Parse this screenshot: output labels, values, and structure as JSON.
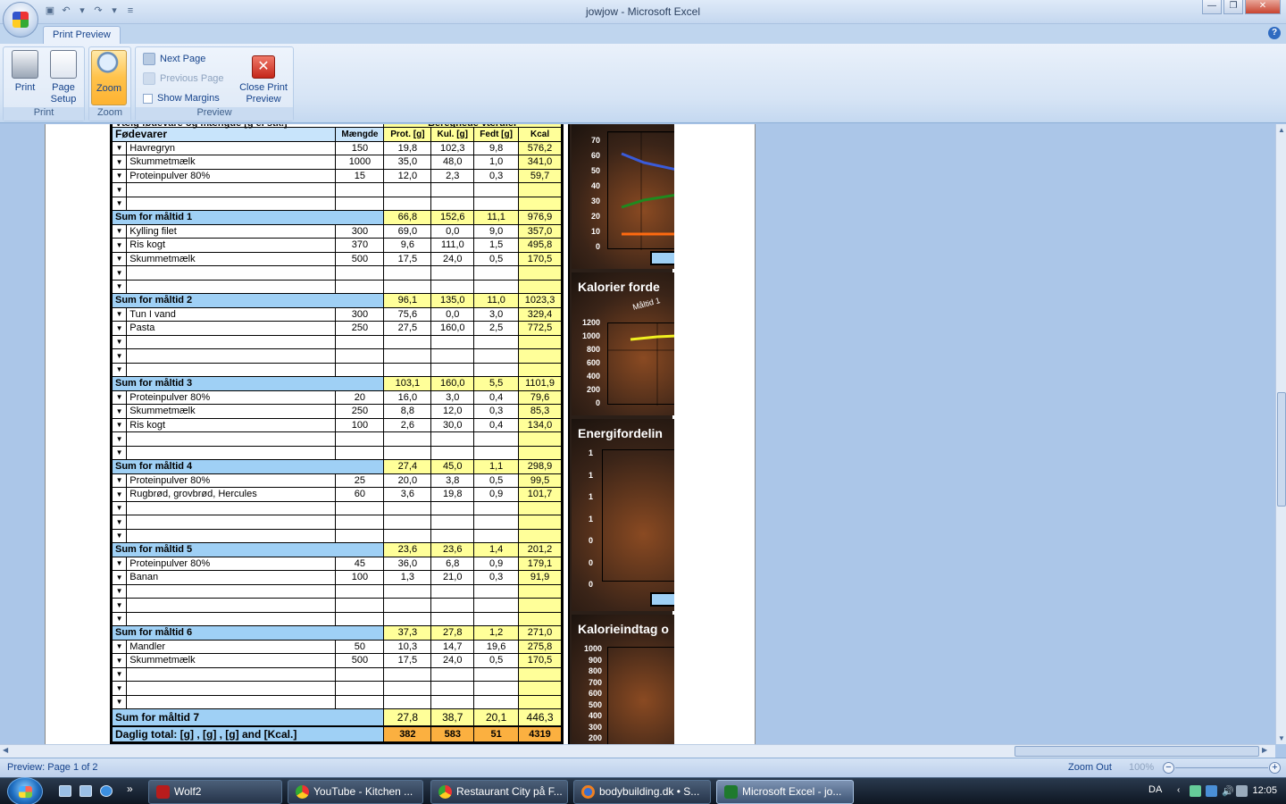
{
  "window": {
    "title": "jowjow - Microsoft Excel"
  },
  "ribbon": {
    "tab": "Print Preview",
    "print_label": "Print",
    "page_setup_label": "Page\nSetup",
    "zoom_label": "Zoom",
    "next_page": "Next Page",
    "previous_page": "Previous Page",
    "show_margins": "Show Margins",
    "close_label": "Close Print\nPreview",
    "group_print": "Print",
    "group_zoom": "Zoom",
    "group_preview": "Preview"
  },
  "sheet": {
    "partial_header_left": "Vælg fødevare og mængde [g el stk.]",
    "partial_header_right": "Beregnede værdier",
    "columns": [
      "Fødevarer",
      "Mængde",
      "Prot. [g]",
      "Kul. [g]",
      "Fedt [g]",
      "Kcal"
    ],
    "rows": [
      {
        "t": "f",
        "name": "Havregryn",
        "qty": "150",
        "p": "19,8",
        "k": "102,3",
        "f": "9,8",
        "kcal": "576,2"
      },
      {
        "t": "f",
        "name": "Skummetmælk",
        "qty": "1000",
        "p": "35,0",
        "k": "48,0",
        "f": "1,0",
        "kcal": "341,0"
      },
      {
        "t": "f",
        "name": "Proteinpulver 80%",
        "qty": "15",
        "p": "12,0",
        "k": "2,3",
        "f": "0,3",
        "kcal": "59,7"
      },
      {
        "t": "f",
        "name": "",
        "qty": "",
        "p": "",
        "k": "",
        "f": "",
        "kcal": ""
      },
      {
        "t": "f",
        "name": "",
        "qty": "",
        "p": "",
        "k": "",
        "f": "",
        "kcal": ""
      },
      {
        "t": "s",
        "name": "Sum for måltid 1",
        "p": "66,8",
        "k": "152,6",
        "f": "11,1",
        "kcal": "976,9"
      },
      {
        "t": "f",
        "name": "Kylling filet",
        "qty": "300",
        "p": "69,0",
        "k": "0,0",
        "f": "9,0",
        "kcal": "357,0"
      },
      {
        "t": "f",
        "name": "Ris kogt",
        "qty": "370",
        "p": "9,6",
        "k": "111,0",
        "f": "1,5",
        "kcal": "495,8"
      },
      {
        "t": "f",
        "name": "Skummetmælk",
        "qty": "500",
        "p": "17,5",
        "k": "24,0",
        "f": "0,5",
        "kcal": "170,5"
      },
      {
        "t": "f",
        "name": "",
        "qty": "",
        "p": "",
        "k": "",
        "f": "",
        "kcal": ""
      },
      {
        "t": "f",
        "name": "",
        "qty": "",
        "p": "",
        "k": "",
        "f": "",
        "kcal": ""
      },
      {
        "t": "s",
        "name": "Sum for måltid 2",
        "p": "96,1",
        "k": "135,0",
        "f": "11,0",
        "kcal": "1023,3"
      },
      {
        "t": "f",
        "name": "Tun I vand",
        "qty": "300",
        "p": "75,6",
        "k": "0,0",
        "f": "3,0",
        "kcal": "329,4"
      },
      {
        "t": "f",
        "name": "Pasta",
        "qty": "250",
        "p": "27,5",
        "k": "160,0",
        "f": "2,5",
        "kcal": "772,5"
      },
      {
        "t": "f",
        "name": "",
        "qty": "",
        "p": "",
        "k": "",
        "f": "",
        "kcal": ""
      },
      {
        "t": "f",
        "name": "",
        "qty": "",
        "p": "",
        "k": "",
        "f": "",
        "kcal": ""
      },
      {
        "t": "f",
        "name": "",
        "qty": "",
        "p": "",
        "k": "",
        "f": "",
        "kcal": ""
      },
      {
        "t": "s",
        "name": "Sum for måltid 3",
        "p": "103,1",
        "k": "160,0",
        "f": "5,5",
        "kcal": "1101,9"
      },
      {
        "t": "f",
        "name": "Proteinpulver 80%",
        "qty": "20",
        "p": "16,0",
        "k": "3,0",
        "f": "0,4",
        "kcal": "79,6"
      },
      {
        "t": "f",
        "name": "Skummetmælk",
        "qty": "250",
        "p": "8,8",
        "k": "12,0",
        "f": "0,3",
        "kcal": "85,3"
      },
      {
        "t": "f",
        "name": "Ris kogt",
        "qty": "100",
        "p": "2,6",
        "k": "30,0",
        "f": "0,4",
        "kcal": "134,0"
      },
      {
        "t": "f",
        "name": "",
        "qty": "",
        "p": "",
        "k": "",
        "f": "",
        "kcal": ""
      },
      {
        "t": "f",
        "name": "",
        "qty": "",
        "p": "",
        "k": "",
        "f": "",
        "kcal": ""
      },
      {
        "t": "s",
        "name": "Sum for måltid 4",
        "p": "27,4",
        "k": "45,0",
        "f": "1,1",
        "kcal": "298,9"
      },
      {
        "t": "f",
        "name": "Proteinpulver 80%",
        "qty": "25",
        "p": "20,0",
        "k": "3,8",
        "f": "0,5",
        "kcal": "99,5"
      },
      {
        "t": "f",
        "name": "Rugbrød, grovbrød, Hercules",
        "qty": "60",
        "p": "3,6",
        "k": "19,8",
        "f": "0,9",
        "kcal": "101,7"
      },
      {
        "t": "f",
        "name": "",
        "qty": "",
        "p": "",
        "k": "",
        "f": "",
        "kcal": ""
      },
      {
        "t": "f",
        "name": "",
        "qty": "",
        "p": "",
        "k": "",
        "f": "",
        "kcal": ""
      },
      {
        "t": "f",
        "name": "",
        "qty": "",
        "p": "",
        "k": "",
        "f": "",
        "kcal": ""
      },
      {
        "t": "s",
        "name": "Sum for måltid 5",
        "p": "23,6",
        "k": "23,6",
        "f": "1,4",
        "kcal": "201,2"
      },
      {
        "t": "f",
        "name": "Proteinpulver 80%",
        "qty": "45",
        "p": "36,0",
        "k": "6,8",
        "f": "0,9",
        "kcal": "179,1"
      },
      {
        "t": "f",
        "name": "Banan",
        "qty": "100",
        "p": "1,3",
        "k": "21,0",
        "f": "0,3",
        "kcal": "91,9"
      },
      {
        "t": "f",
        "name": "",
        "qty": "",
        "p": "",
        "k": "",
        "f": "",
        "kcal": ""
      },
      {
        "t": "f",
        "name": "",
        "qty": "",
        "p": "",
        "k": "",
        "f": "",
        "kcal": ""
      },
      {
        "t": "f",
        "name": "",
        "qty": "",
        "p": "",
        "k": "",
        "f": "",
        "kcal": ""
      },
      {
        "t": "s",
        "name": "Sum for måltid 6",
        "p": "37,3",
        "k": "27,8",
        "f": "1,2",
        "kcal": "271,0"
      },
      {
        "t": "f",
        "name": "Mandler",
        "qty": "50",
        "p": "10,3",
        "k": "14,7",
        "f": "19,6",
        "kcal": "275,8"
      },
      {
        "t": "f",
        "name": "Skummetmælk",
        "qty": "500",
        "p": "17,5",
        "k": "24,0",
        "f": "0,5",
        "kcal": "170,5"
      },
      {
        "t": "f",
        "name": "",
        "qty": "",
        "p": "",
        "k": "",
        "f": "",
        "kcal": ""
      },
      {
        "t": "f",
        "name": "",
        "qty": "",
        "p": "",
        "k": "",
        "f": "",
        "kcal": ""
      },
      {
        "t": "f",
        "name": "",
        "qty": "",
        "p": "",
        "k": "",
        "f": "",
        "kcal": ""
      },
      {
        "t": "s7",
        "name": "Sum for måltid 7",
        "p": "27,8",
        "k": "38,7",
        "f": "20,1",
        "kcal": "446,3"
      },
      {
        "t": "total",
        "name": "Daglig total: [g] , [g] , [g] and [Kcal.]",
        "p": "382",
        "k": "583",
        "f": "51",
        "kcal": "4319"
      }
    ]
  },
  "charts": {
    "c1_yticks": [
      "70",
      "60",
      "50",
      "40",
      "30",
      "20",
      "10",
      "0"
    ],
    "c2_title": "Kalorier forde",
    "c2_sub": "Måltid 1",
    "c2_yticks": [
      "1200",
      "1000",
      "800",
      "600",
      "400",
      "200",
      "0"
    ],
    "c3_title": "Energifordelin",
    "c3_yticks": [
      "1",
      "1",
      "1",
      "1",
      "0",
      "0",
      "0"
    ],
    "c4_title": "Kalorieindtag o",
    "c4_yticks": [
      "1000",
      "900",
      "800",
      "700",
      "600",
      "500",
      "400",
      "300",
      "200"
    ],
    "colors": {
      "blue": "#3a5bd9",
      "green": "#1f8a1f",
      "orange": "#ff6a10",
      "yellow": "#f0f020"
    }
  },
  "status": {
    "text": "Preview: Page 1 of 2",
    "zoom_out": "Zoom Out",
    "zoom_pct": "100%"
  },
  "taskbar": {
    "items": [
      "Wolf2",
      "YouTube - Kitchen ...",
      "Restaurant City på F...",
      "bodybuilding.dk • S...",
      "Microsoft Excel - jo..."
    ],
    "lang": "DA",
    "clock": "12:05"
  }
}
